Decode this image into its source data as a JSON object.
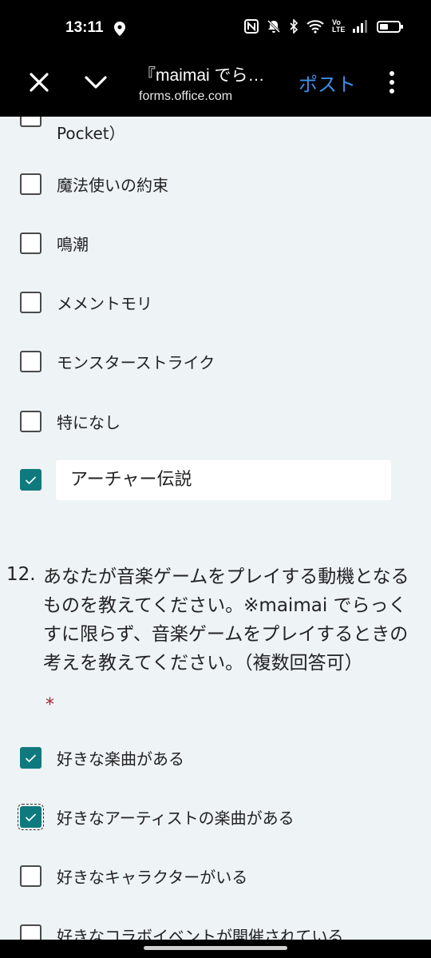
{
  "status": {
    "time": "13:11",
    "network": "Vo LTE",
    "icons": [
      "location-icon",
      "nfc-icon",
      "mute-icon",
      "bluetooth-icon",
      "wifi-icon",
      "signal-icon",
      "battery-icon"
    ]
  },
  "appbar": {
    "title": "『maimai でら…",
    "url": "forms.office.com",
    "post_label": "ポスト"
  },
  "options_prev": [
    {
      "label": "Pocket）",
      "checked": false
    },
    {
      "label": "魔法使いの約束",
      "checked": false
    },
    {
      "label": "鳴潮",
      "checked": false
    },
    {
      "label": "メメントモリ",
      "checked": false
    },
    {
      "label": "モンスターストライク",
      "checked": false
    },
    {
      "label": "特になし",
      "checked": false
    }
  ],
  "other": {
    "checked": true,
    "value": "アーチャー伝説"
  },
  "question": {
    "number": "12.",
    "text": "あなたが音楽ゲームをプレイする動機となるものを教えてください。※maimai でらっくすに限らず、音楽ゲームをプレイするときの考えを教えてください。（複数回答可）",
    "required_mark": "*"
  },
  "options_q12": [
    {
      "label": "好きな楽曲がある",
      "checked": true
    },
    {
      "label": "好きなアーティストの楽曲がある",
      "checked": true
    },
    {
      "label": "好きなキャラクターがいる",
      "checked": false
    },
    {
      "label": "好きなコラボイベントが開催されている",
      "checked": false
    }
  ],
  "colors": {
    "accent": "#0e7a7e",
    "link": "#3d8fe8",
    "required": "#a4262c",
    "background": "#eef3f6"
  }
}
